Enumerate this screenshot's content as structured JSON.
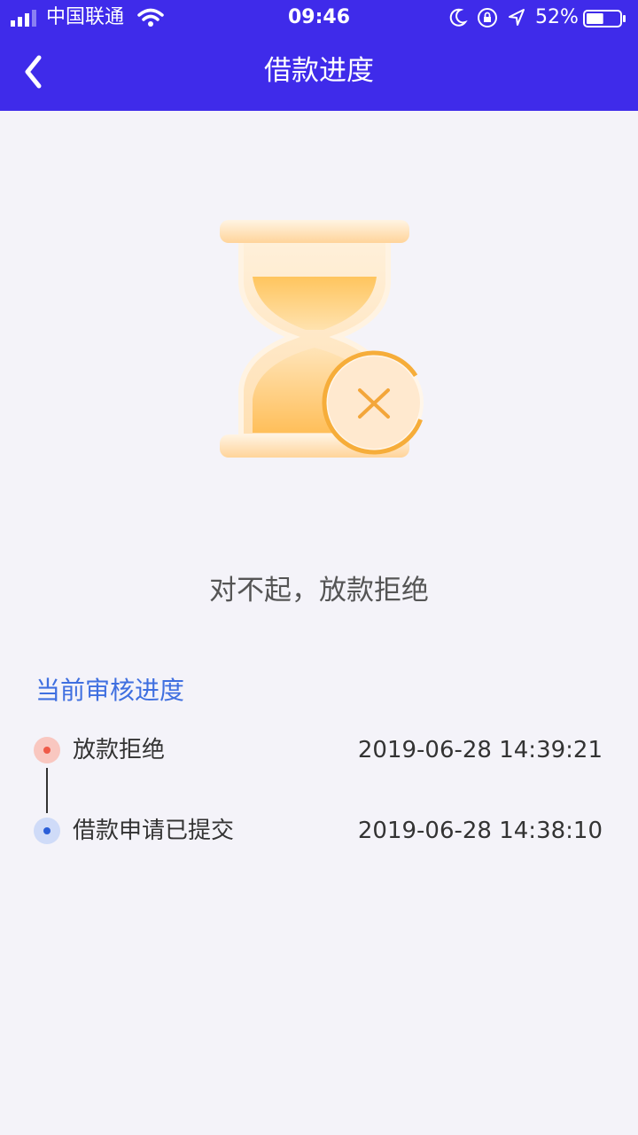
{
  "status_bar": {
    "carrier": "中国联通",
    "time": "09:46",
    "battery_percent": "52%",
    "battery_level": 0.52
  },
  "nav": {
    "title": "借款进度",
    "back_icon": "chevron-left-icon"
  },
  "hero": {
    "icon": "hourglass-rejected-icon",
    "message": "对不起，放款拒绝"
  },
  "progress": {
    "title": "当前审核进度",
    "items": [
      {
        "label": "放款拒绝",
        "timestamp": "2019-06-28 14:39:21",
        "status": "rejected"
      },
      {
        "label": "借款申请已提交",
        "timestamp": "2019-06-28 14:38:10",
        "status": "submitted"
      }
    ]
  },
  "colors": {
    "header_bg": "#3f2bea",
    "accent_blue": "#3f6fe0",
    "reject_red": "#ef5a48",
    "submitted_blue": "#2a5ed8",
    "page_bg": "#f4f3f9"
  }
}
